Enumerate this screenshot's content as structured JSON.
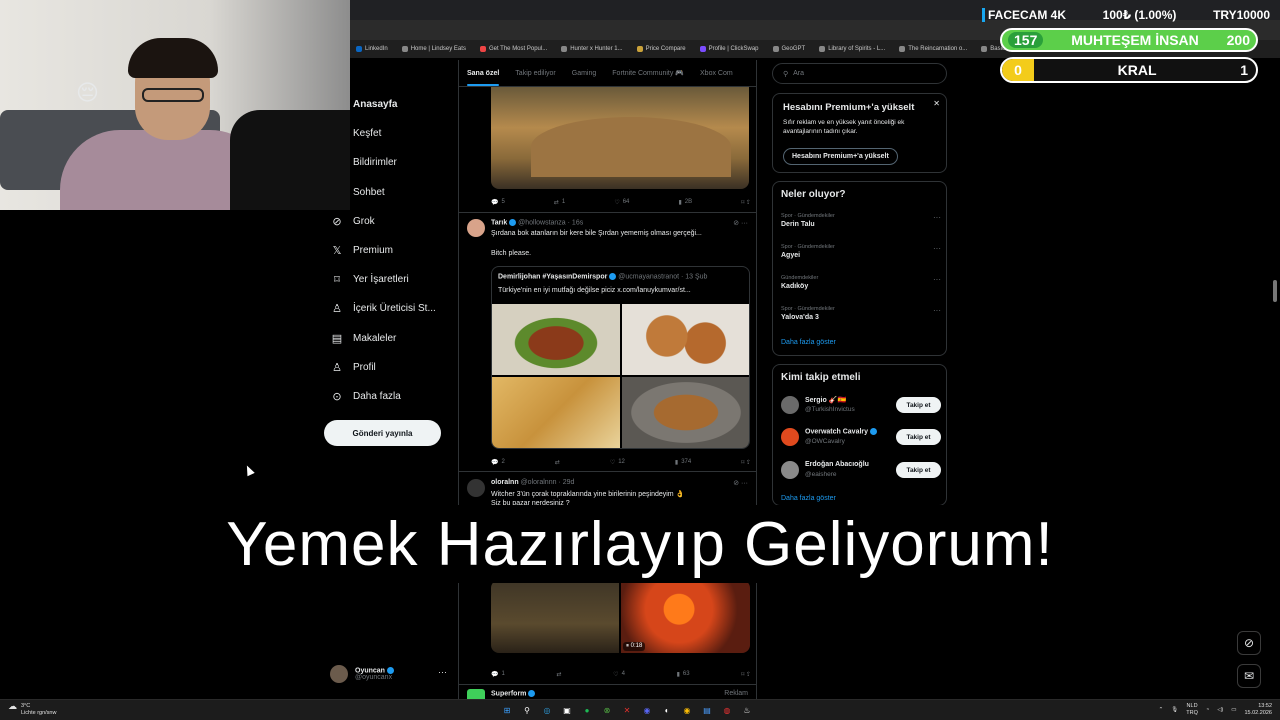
{
  "browser": {
    "bookmarks": [
      "LinkedIn",
      "Home | Lindsey Eats",
      "Get The Most Popul...",
      "Hunter x Hunter 1...",
      "Price Compare",
      "Profile | ClickSwap",
      "GeoGPT",
      "Library of Spirits - L...",
      "The Reincarnation o...",
      "Basics of Online M..."
    ]
  },
  "overlay": {
    "facecam_label": "FACECAM 4K",
    "donation": "100₺ (1.00%)",
    "leader": "TRY10000",
    "goal1_left": "157",
    "goal1_label": "MUHTEŞEM İNSAN",
    "goal1_right": "200",
    "goal2_left": "0",
    "goal2_label": "KRAL",
    "goal2_right": "1",
    "caption": "Yemek Hazırlayıp Geliyorum!"
  },
  "nav": {
    "items": [
      {
        "label": "Anasayfa",
        "icon": "home-icon"
      },
      {
        "label": "Keşfet",
        "icon": "search-icon"
      },
      {
        "label": "Bildirimler",
        "icon": "bell-icon"
      },
      {
        "label": "Sohbet",
        "icon": "chat-icon"
      },
      {
        "label": "Grok",
        "icon": "grok-icon"
      },
      {
        "label": "Premium",
        "icon": "x-logo-icon"
      },
      {
        "label": "Yer İşaretleri",
        "icon": "bookmark-icon"
      },
      {
        "label": "İçerik Üreticisi St...",
        "icon": "creator-studio-icon"
      },
      {
        "label": "Makaleler",
        "icon": "articles-icon"
      },
      {
        "label": "Profil",
        "icon": "profile-icon"
      },
      {
        "label": "Daha fazla",
        "icon": "more-circle-icon"
      }
    ],
    "post_button": "Gönderi yayınla",
    "account_name": "Oyuncan",
    "account_handle": "@oyuncanx"
  },
  "timeline": {
    "tabs": [
      "Sana özel",
      "Takip ediliyor",
      "Gaming",
      "Fortnite Community 🎮",
      "Xbox Com"
    ],
    "post1_actions": {
      "replies": "5",
      "reposts": "1",
      "likes": "64",
      "views": "2B"
    },
    "post2": {
      "name": "Tarık",
      "handle": "@hollowstanza · 16s",
      "text": "Şırdana bok atanların bir kere bile Şırdan yememiş olması gerçeği...",
      "text2": "Bitch please.",
      "quote_name": "Demirlijohan #YaşasınDemirspor",
      "quote_handle": "@ucmayanastranot · 13 Şub",
      "quote_text": "Türkiye'nin en iyi mutfağı değilse piciz  x.com/lanuykumvar/st...",
      "actions": {
        "replies": "2",
        "reposts": "",
        "likes": "12",
        "views": "374"
      }
    },
    "post3": {
      "name": "oloralnn",
      "handle": "@oloralnnn · 29d",
      "text": "Witcher 3'ün çorak topraklarında yine birilerinin peşindeyim 👌",
      "text2": "Siz bu pazar nerdesiniz ?",
      "video_time": "0:18",
      "actions": {
        "replies": "1",
        "reposts": "",
        "likes": "4",
        "views": "63"
      }
    },
    "post4_name": "Superform",
    "post4_tag": "Reklam"
  },
  "sidebar": {
    "search_placeholder": "Ara",
    "premium_title": "Hesabını Premium+'a yükselt",
    "premium_text1": "Sıfır reklam ve en yüksek yanıt önceliği ek",
    "premium_text2": "avantajlarının tadını çıkar.",
    "premium_button": "Hesabını Premium+'a yükselt",
    "trends_title": "Neler oluyor?",
    "trends": [
      {
        "cat": "Spor · Gündemdekiler",
        "name": "Derin Talu"
      },
      {
        "cat": "Spor · Gündemdekiler",
        "name": "Agyei"
      },
      {
        "cat": "Gündemdekiler",
        "name": "Kadıköy"
      },
      {
        "cat": "Spor · Gündemdekiler",
        "name": "Yalova'da 3"
      }
    ],
    "show_more": "Daha fazla göster",
    "follow_title": "Kimi takip etmeli",
    "follow": [
      {
        "name": "Sergio 🎸🇪🇸",
        "handle": "@TurkishInvictus",
        "button": "Takip et"
      },
      {
        "name": "Overwatch Cavalry",
        "handle": "@OWCavalry",
        "button": "Takip et"
      },
      {
        "name": "Erdoğan Abacıoğlu",
        "handle": "@eaishere",
        "button": "Takip et"
      }
    ],
    "follow_more": "Daha fazla göster"
  },
  "taskbar": {
    "temp": "3°C",
    "weather": "Lichte rgn/snw",
    "lang1": "NLD",
    "lang2": "TRQ",
    "time": "13:52",
    "date": "15.02.2026"
  }
}
